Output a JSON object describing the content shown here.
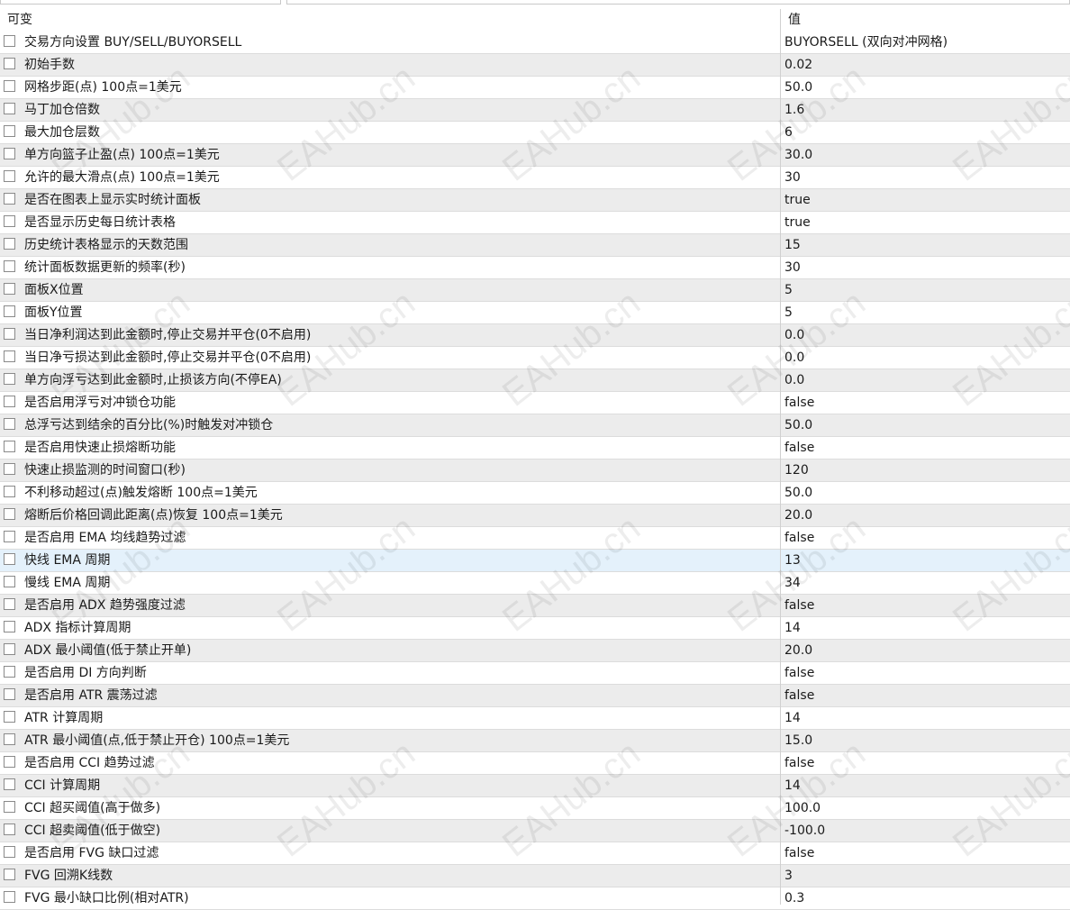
{
  "header": {
    "name": "可变",
    "value": "值"
  },
  "watermark": "EAHub.cn",
  "rows": [
    {
      "name": "交易方向设置 BUY/SELL/BUYORSELL",
      "value": "BUYORSELL (双向对冲网格)"
    },
    {
      "name": "初始手数",
      "value": "0.02"
    },
    {
      "name": "网格步距(点) 100点=1美元",
      "value": "50.0"
    },
    {
      "name": "马丁加仓倍数",
      "value": "1.6"
    },
    {
      "name": "最大加仓层数",
      "value": "6"
    },
    {
      "name": "单方向篮子止盈(点) 100点=1美元",
      "value": "30.0"
    },
    {
      "name": "允许的最大滑点(点) 100点=1美元",
      "value": "30"
    },
    {
      "name": "是否在图表上显示实时统计面板",
      "value": "true"
    },
    {
      "name": "是否显示历史每日统计表格",
      "value": "true"
    },
    {
      "name": "历史统计表格显示的天数范围",
      "value": "15"
    },
    {
      "name": "统计面板数据更新的频率(秒)",
      "value": "30"
    },
    {
      "name": "面板X位置",
      "value": "5"
    },
    {
      "name": "面板Y位置",
      "value": "5"
    },
    {
      "name": "当日净利润达到此金额时,停止交易并平仓(0不启用)",
      "value": "0.0"
    },
    {
      "name": "当日净亏损达到此金额时,停止交易并平仓(0不启用)",
      "value": "0.0"
    },
    {
      "name": "单方向浮亏达到此金额时,止损该方向(不停EA)",
      "value": "0.0"
    },
    {
      "name": "是否启用浮亏对冲锁仓功能",
      "value": "false"
    },
    {
      "name": "总浮亏达到结余的百分比(%)时触发对冲锁仓",
      "value": "50.0"
    },
    {
      "name": "是否启用快速止损熔断功能",
      "value": "false"
    },
    {
      "name": "快速止损监测的时间窗口(秒)",
      "value": "120"
    },
    {
      "name": "不利移动超过(点)触发熔断 100点=1美元",
      "value": "50.0"
    },
    {
      "name": "熔断后价格回调此距离(点)恢复 100点=1美元",
      "value": "20.0"
    },
    {
      "name": "是否启用 EMA 均线趋势过滤",
      "value": "false"
    },
    {
      "name": "快线 EMA 周期",
      "value": "13"
    },
    {
      "name": "慢线 EMA 周期",
      "value": "34"
    },
    {
      "name": "是否启用 ADX 趋势强度过滤",
      "value": "false"
    },
    {
      "name": "ADX 指标计算周期",
      "value": "14"
    },
    {
      "name": "ADX 最小阈值(低于禁止开单)",
      "value": "20.0"
    },
    {
      "name": "是否启用 DI 方向判断",
      "value": "false"
    },
    {
      "name": "是否启用 ATR 震荡过滤",
      "value": "false"
    },
    {
      "name": "ATR 计算周期",
      "value": "14"
    },
    {
      "name": "ATR 最小阈值(点,低于禁止开仓) 100点=1美元",
      "value": "15.0"
    },
    {
      "name": "是否启用 CCI 趋势过滤",
      "value": "false"
    },
    {
      "name": "CCI 计算周期",
      "value": "14"
    },
    {
      "name": "CCI 超买阈值(高于做多)",
      "value": "100.0"
    },
    {
      "name": "CCI 超卖阈值(低于做空)",
      "value": "-100.0"
    },
    {
      "name": "是否启用 FVG 缺口过滤",
      "value": "false"
    },
    {
      "name": "FVG 回溯K线数",
      "value": "3"
    },
    {
      "name": "FVG 最小缺口比例(相对ATR)",
      "value": "0.3"
    }
  ],
  "selected_row": 23,
  "colors": {
    "row_alt": "#ececec",
    "row_selected": "#e4f1fb",
    "grid_line": "#dcdcdc"
  }
}
